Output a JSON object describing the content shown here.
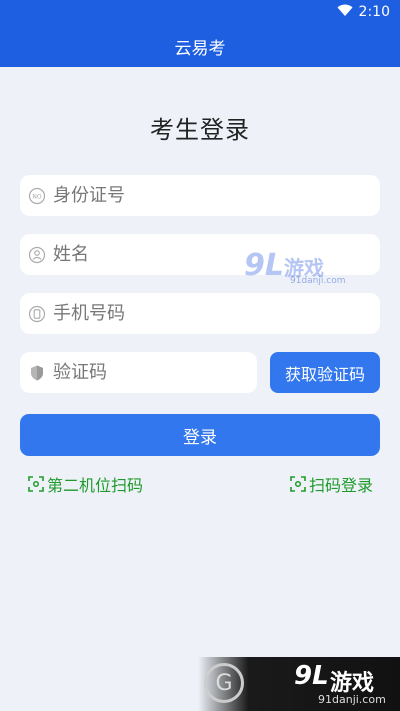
{
  "status_bar": {
    "time": "2:10"
  },
  "header": {
    "title": "云易考"
  },
  "page": {
    "title": "考生登录"
  },
  "form": {
    "id_placeholder": "身份证号",
    "name_placeholder": "姓名",
    "phone_placeholder": "手机号码",
    "code_placeholder": "验证码",
    "get_code_label": "获取验证码",
    "login_label": "登录"
  },
  "links": {
    "second_camera_label": "第二机位扫码",
    "scan_login_label": "扫码登录"
  },
  "watermark": {
    "brand_num": "9L",
    "brand_cn": "游戏",
    "domain": "91danji.com"
  },
  "colors": {
    "primary": "#1d5fe0",
    "button": "#3377ee",
    "link": "#1e9a2a"
  }
}
